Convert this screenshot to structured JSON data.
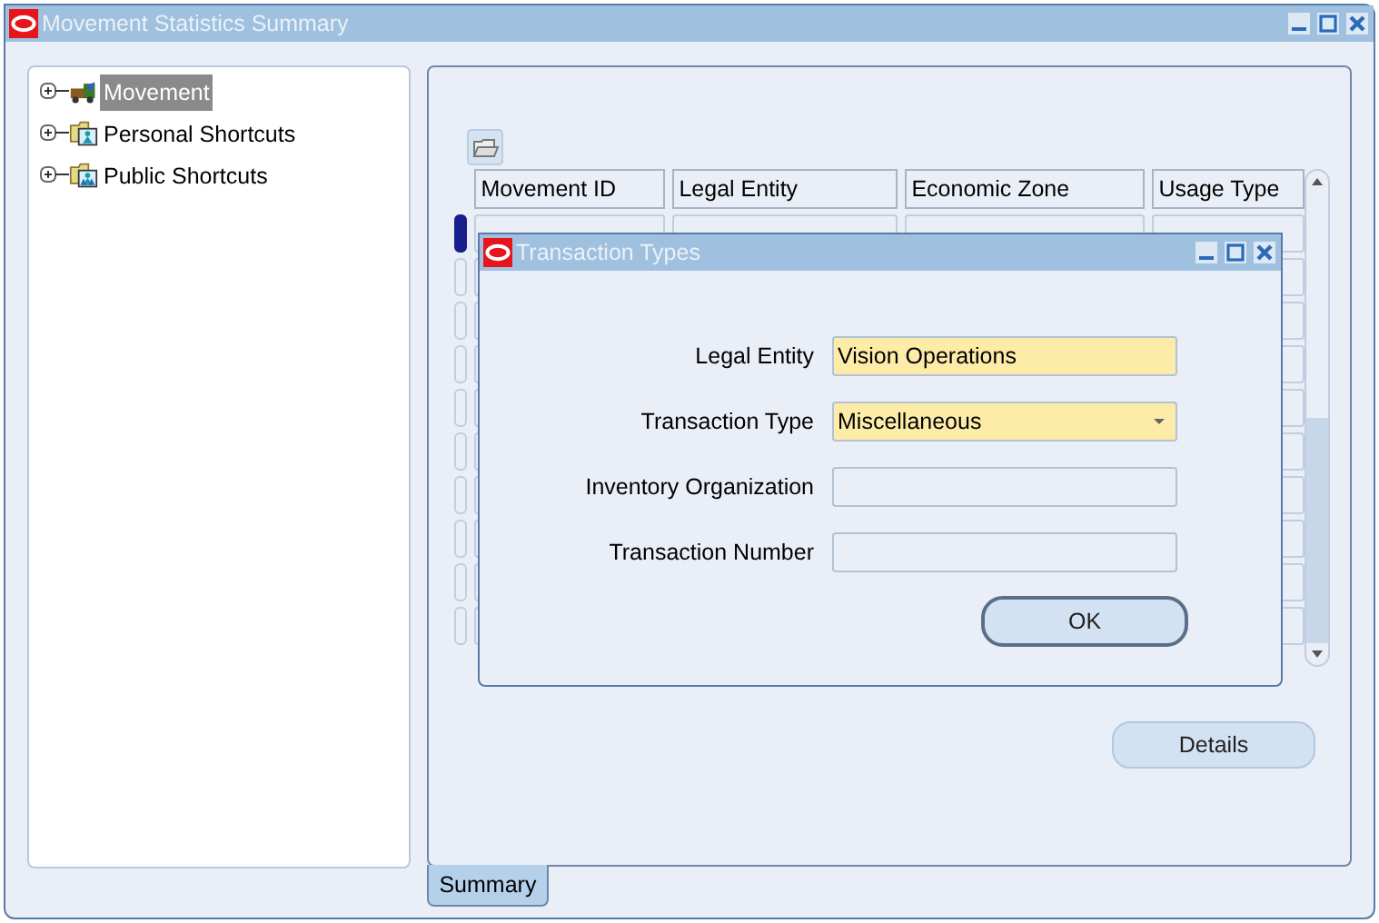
{
  "window": {
    "title": "Movement Statistics Summary"
  },
  "tree": {
    "items": [
      {
        "label": "Movement",
        "kind": "movement",
        "selected": true,
        "expanded": false
      },
      {
        "label": "Personal Shortcuts",
        "kind": "personal",
        "selected": false,
        "expanded": false
      },
      {
        "label": "Public Shortcuts",
        "kind": "public",
        "selected": false,
        "expanded": false
      }
    ]
  },
  "table": {
    "columns": [
      "Movement ID",
      "Legal Entity",
      "Economic Zone",
      "Usage Type"
    ],
    "rows": [
      {
        "current": true
      },
      {
        "current": false
      },
      {
        "current": false
      },
      {
        "current": false
      },
      {
        "current": false
      },
      {
        "current": false
      },
      {
        "current": false
      },
      {
        "current": false
      },
      {
        "current": false
      },
      {
        "current": false
      }
    ]
  },
  "details_button": "Details",
  "tabs": [
    {
      "label": "Summary",
      "selected": true
    }
  ],
  "dialog": {
    "title": "Transaction Types",
    "fields": [
      {
        "label": "Legal Entity",
        "kind": "text",
        "value": "Vision Operations",
        "required": true
      },
      {
        "label": "Transaction Type",
        "kind": "dropdown",
        "value": "Miscellaneous",
        "required": true
      },
      {
        "label": "Inventory Organization",
        "kind": "text",
        "required": false
      },
      {
        "label": "Transaction Number",
        "kind": "text",
        "required": false
      }
    ],
    "ok_button": "OK"
  }
}
